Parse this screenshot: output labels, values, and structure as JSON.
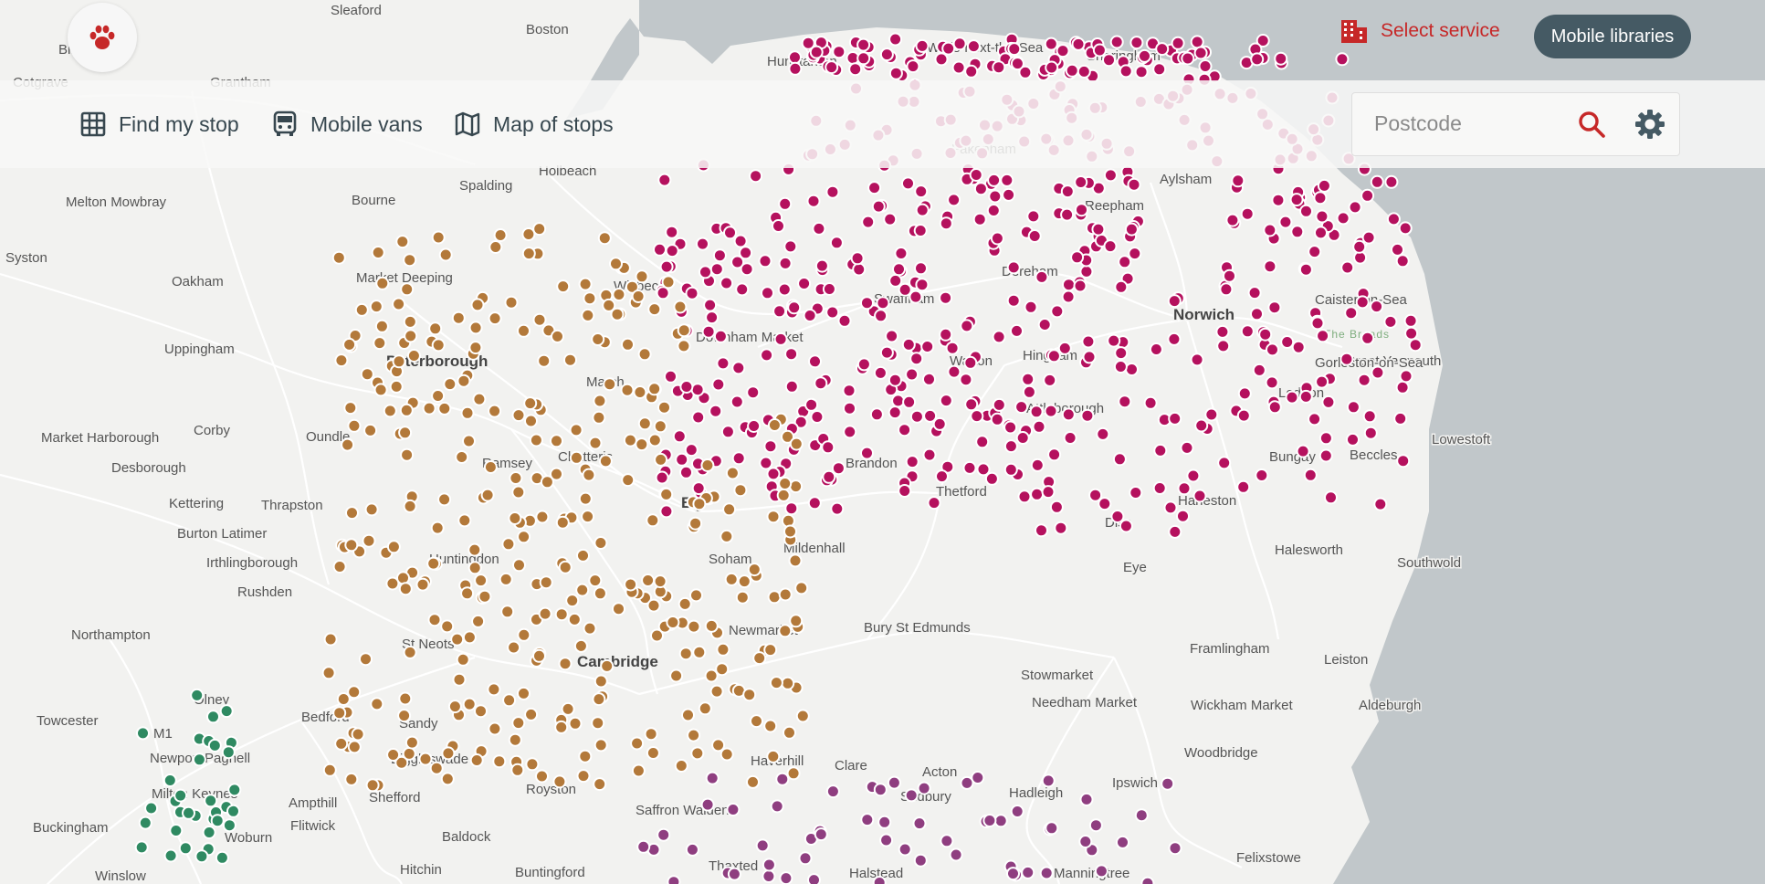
{
  "header": {
    "logo_icon": "paw-icon",
    "select_service_label": "Select service",
    "mobile_libraries_label": "Mobile libraries"
  },
  "nav": {
    "items": [
      {
        "label": "Find my stop",
        "icon": "grid-icon"
      },
      {
        "label": "Mobile vans",
        "icon": "bus-icon"
      },
      {
        "label": "Map of stops",
        "icon": "map-icon"
      }
    ]
  },
  "search": {
    "placeholder": "Postcode",
    "search_icon": "search-icon",
    "settings_icon": "gear-icon"
  },
  "colors": {
    "accent": "#c62828",
    "nav_text": "#37474f",
    "button_bg": "#455a64",
    "sea": "#c1c7ca",
    "land": "#f2f2f0",
    "stops_norfolk": "#b5115e",
    "stops_cambridgeshire": "#b3793a",
    "stops_milton_keynes": "#2f8a62",
    "stops_essex": "#8f3e80"
  },
  "map": {
    "places": [
      "Sleaford",
      "Boston",
      "Hunstanton",
      "Wells-next-the-Sea",
      "Sheringham",
      "Grantham",
      "Cotgrave",
      "Bingham",
      "Holbeach",
      "Spalding",
      "Fakenham",
      "Aylsham",
      "Melton Mowbray",
      "Bourne",
      "Reepham",
      "Syston",
      "Market Deeping",
      "Dereham",
      "Oakham",
      "Swaffham",
      "Norwich",
      "Caister-on-Sea",
      "Downham Market",
      "Wisbech",
      "Peterborough",
      "Uppingham",
      "Watton",
      "Hingham",
      "Great Yarmouth",
      "Gorleston-on-Sea",
      "March",
      "Attleborough",
      "Loddon",
      "Corby",
      "Market Harborough",
      "Oundle",
      "Ramsey",
      "Chatteris",
      "Brandon",
      "Bungay",
      "Beccles",
      "Lowestoft",
      "Desborough",
      "Thetford",
      "Ely",
      "Harleston",
      "Diss",
      "Kettering",
      "Thrapston",
      "Burton Latimer",
      "Mildenhall",
      "Halesworth",
      "Southwold",
      "Irthlingborough",
      "Huntingdon",
      "Soham",
      "Rushden",
      "Eye",
      "Newmarket",
      "Bury St Edmunds",
      "Northampton",
      "St Neots",
      "Cambridge",
      "Framlingham",
      "Leiston",
      "Stowmarket",
      "Olney",
      "Needham Market",
      "Wickham Market",
      "Aldeburgh",
      "Towcester",
      "Bedford",
      "Sandy",
      "Newport Pagnell",
      "Haverhill",
      "Clare",
      "Acton",
      "Woodbridge",
      "Biggleswade",
      "Royston",
      "Sudbury",
      "Hadleigh",
      "Ipswich",
      "Milton Keynes",
      "Shefford",
      "Ampthill",
      "Saffron Walden",
      "Flitwick",
      "Buckingham",
      "Woburn",
      "Baldock",
      "Felixstowe",
      "Thaxted",
      "Halstead",
      "Manningtree",
      "Hitchin",
      "Winslow",
      "Buntingford",
      "The Broads",
      "M1"
    ]
  }
}
